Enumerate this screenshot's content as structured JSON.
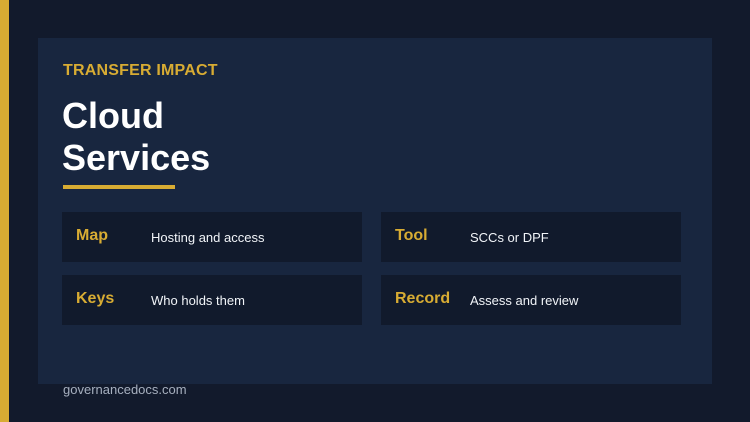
{
  "eyebrow": "TRANSFER IMPACT",
  "title": {
    "line_1": "Cloud",
    "line_2": "Services"
  },
  "items": [
    {
      "label": "Map",
      "value": "Hosting and access"
    },
    {
      "label": "Tool",
      "value": "SCCs or DPF"
    },
    {
      "label": "Keys",
      "value": "Who holds them"
    },
    {
      "label": "Record",
      "value": "Assess and review"
    }
  ],
  "footer": "governancedocs.com",
  "colors": {
    "background": "#121a2c",
    "panel": "#18263f",
    "card": "#111a2c",
    "accent": "#d8ac33",
    "title_text": "#ffffff",
    "body_text": "#f1f4f8",
    "footer_text": "#a7b0bf"
  }
}
